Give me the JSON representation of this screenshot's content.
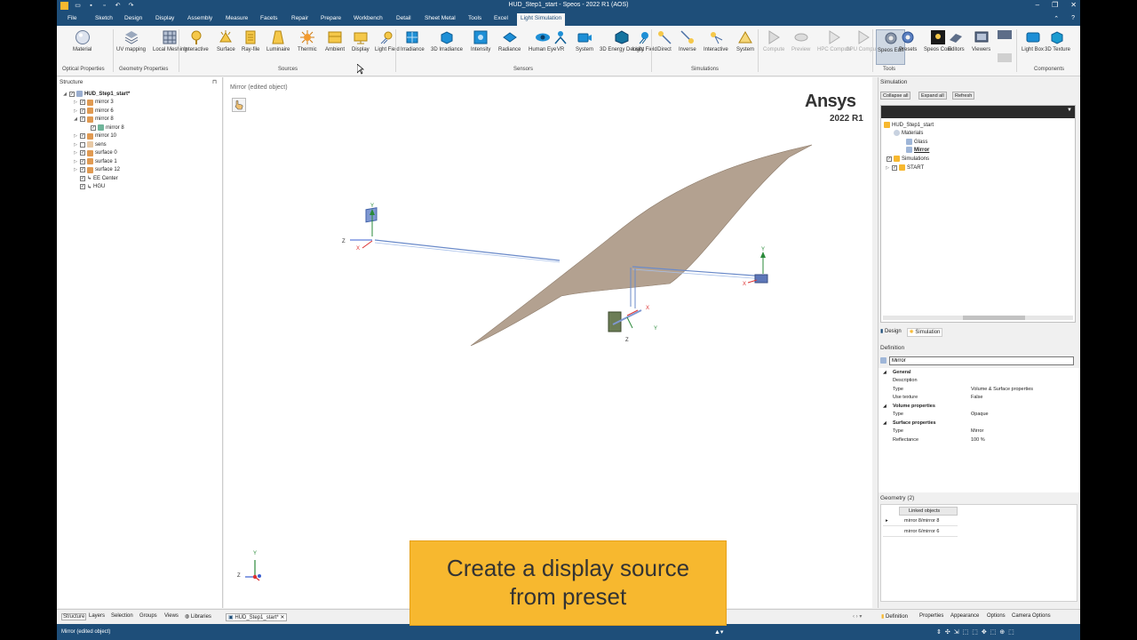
{
  "window": {
    "title": "HUD_Step1_start - Speos - 2022 R1 (AOS)",
    "controls": [
      "–",
      "❐",
      "✕"
    ]
  },
  "menu": {
    "tabs": [
      {
        "label": "File"
      },
      {
        "label": "Sketch"
      },
      {
        "label": "Design"
      },
      {
        "label": "Display"
      },
      {
        "label": "Assembly"
      },
      {
        "label": "Measure"
      },
      {
        "label": "Facets"
      },
      {
        "label": "Repair"
      },
      {
        "label": "Prepare"
      },
      {
        "label": "Workbench"
      },
      {
        "label": "Detail"
      },
      {
        "label": "Sheet Metal"
      },
      {
        "label": "Tools"
      },
      {
        "label": "Excel"
      },
      {
        "label": "Light Simulation"
      }
    ],
    "active": "Light Simulation"
  },
  "ribbon": {
    "buttons": [
      {
        "id": "material",
        "label": "Material"
      },
      {
        "id": "uv-mapping",
        "label": "UV mapping"
      },
      {
        "id": "local-meshing",
        "label": "Local Meshing"
      },
      {
        "id": "interactive",
        "label": "Interactive"
      },
      {
        "id": "surface",
        "label": "Surface"
      },
      {
        "id": "ray-file",
        "label": "Ray-file"
      },
      {
        "id": "luminaire",
        "label": "Luminaire"
      },
      {
        "id": "thermic",
        "label": "Thermic"
      },
      {
        "id": "ambient",
        "label": "Ambient"
      },
      {
        "id": "display",
        "label": "Display"
      },
      {
        "id": "light-field",
        "label": "Light Field"
      },
      {
        "id": "irradiance",
        "label": "Irradiance"
      },
      {
        "id": "3d-irradiance",
        "label": "3D Irradiance"
      },
      {
        "id": "intensity",
        "label": "Intensity"
      },
      {
        "id": "radiance",
        "label": "Radiance"
      },
      {
        "id": "human-eye",
        "label": "Human Eye"
      },
      {
        "id": "vr",
        "label": "VR"
      },
      {
        "id": "camera",
        "label": "System"
      },
      {
        "id": "3d-energy-density",
        "label": "3D Energy Density"
      },
      {
        "id": "light-field-sensor",
        "label": "Light Field"
      },
      {
        "id": "direct",
        "label": "Direct"
      },
      {
        "id": "inverse",
        "label": "Inverse"
      },
      {
        "id": "interactive-sim",
        "label": "Interactive"
      },
      {
        "id": "system-sim",
        "label": "System"
      },
      {
        "id": "compute",
        "label": "Compute"
      },
      {
        "id": "preview",
        "label": "Preview"
      },
      {
        "id": "hpc-compute",
        "label": "HPC Compute"
      },
      {
        "id": "gpu-compute",
        "label": "GPU Compute"
      },
      {
        "id": "speos-edit",
        "label": "Speos Edit"
      },
      {
        "id": "presets",
        "label": "Presets"
      },
      {
        "id": "speos-core",
        "label": "Speos Core"
      },
      {
        "id": "editors",
        "label": "Editors"
      },
      {
        "id": "viewers",
        "label": "Viewers"
      },
      {
        "id": "light-box",
        "label": "Light Box"
      },
      {
        "id": "3d-texture",
        "label": "3D Texture"
      }
    ],
    "groups": {
      "optical": "Optical Properties",
      "geometry": "Geometry Properties",
      "sources": "Sources",
      "sensors": "Sensors",
      "simulations": "Simulations",
      "tools": "Tools",
      "components": "Components"
    }
  },
  "structure": {
    "title": "Structure",
    "items": [
      {
        "label": "HUD_Step1_start*",
        "bold": true
      },
      {
        "label": "mirror 3"
      },
      {
        "label": "mirror 6"
      },
      {
        "label": "mirror 8"
      },
      {
        "label": "mirror 8"
      },
      {
        "label": "mirror 10"
      },
      {
        "label": "sens"
      },
      {
        "label": "surface 0"
      },
      {
        "label": "surface 1"
      },
      {
        "label": "surface 12"
      },
      {
        "label": "EE Center"
      },
      {
        "label": "HGU"
      }
    ]
  },
  "viewport": {
    "label": "Mirror (edited object)",
    "brand": "Ansys",
    "version": "2022 R1",
    "axes": {
      "x": "X",
      "y": "Y",
      "z": "Z"
    }
  },
  "simulation": {
    "title": "Simulation",
    "buttons": {
      "collapse": "Collapse all",
      "expand": "Expand all",
      "refresh": "Refresh"
    },
    "tree": [
      {
        "label": "HUD_Step1_start"
      },
      {
        "label": "Materials"
      },
      {
        "label": "Glass"
      },
      {
        "label": "Mirror",
        "bold": true
      },
      {
        "label": "Simulations"
      },
      {
        "label": "START"
      }
    ],
    "tabs": {
      "design": "Design",
      "simulation": "Simulation"
    }
  },
  "definition": {
    "title": "Definition",
    "name_value": "Mirror",
    "rows": [
      {
        "key": "General",
        "value": "",
        "section": true
      },
      {
        "key": "Description",
        "value": ""
      },
      {
        "key": "Type",
        "value": "Volume & Surface properties"
      },
      {
        "key": "Use texture",
        "value": "False"
      },
      {
        "key": "Volume properties",
        "value": "",
        "section": true
      },
      {
        "key": "Type",
        "value": "Opaque"
      },
      {
        "key": "Surface properties",
        "value": "",
        "section": true
      },
      {
        "key": "Type",
        "value": "Mirror"
      },
      {
        "key": "Reflectance",
        "value": "100 %"
      }
    ]
  },
  "geometry": {
    "title": "Geometry (2)",
    "header": "Linked objects",
    "rows": [
      "mirror 8/mirror 8",
      "mirror 6/mirror 6"
    ]
  },
  "bottom_tabs": {
    "left": [
      "Structure",
      "Layers",
      "Selection",
      "Groups",
      "Views",
      "Libraries"
    ],
    "doc": "HUD_Step1_start*",
    "right": [
      "Definition",
      "Properties",
      "Appearance",
      "Options",
      "Camera Options"
    ]
  },
  "status": {
    "text": "Mirror (edited object)"
  },
  "caption": {
    "line1": "Create a display source",
    "line2": "from preset"
  },
  "colors": {
    "titlebar": "#1e4e79",
    "caption": "#f7b82f",
    "surface": "#b3a190"
  }
}
